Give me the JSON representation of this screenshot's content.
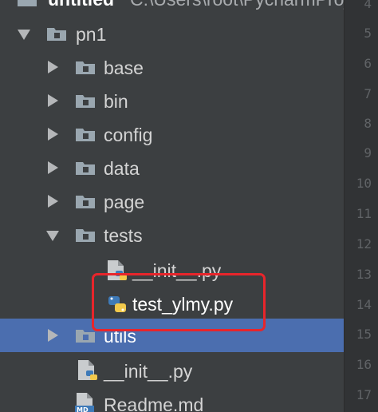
{
  "project_header": {
    "name": "untitled",
    "path": "C:\\Users\\root\\PycharmProjects\\untitled"
  },
  "tree": {
    "root": {
      "name": "pn1",
      "expanded": true
    },
    "folders": [
      {
        "name": "base",
        "expanded": false
      },
      {
        "name": "bin",
        "expanded": false
      },
      {
        "name": "config",
        "expanded": false
      },
      {
        "name": "data",
        "expanded": false
      },
      {
        "name": "page",
        "expanded": false
      },
      {
        "name": "tests",
        "expanded": true
      },
      {
        "name": "utils",
        "expanded": false,
        "selected": true
      }
    ],
    "tests_children": [
      {
        "name": "__init__.py",
        "icon": "python-file-icon"
      },
      {
        "name": "test_ylmy.py",
        "icon": "python-file-icon"
      }
    ],
    "root_files": [
      {
        "name": "__init__.py",
        "icon": "python-file-icon"
      },
      {
        "name": "Readme.md",
        "icon": "markdown-file-icon",
        "badge": "MD"
      }
    ]
  },
  "gutter": {
    "line_numbers": [
      "4",
      "5",
      "6",
      "7",
      "8",
      "9",
      "10",
      "11",
      "12",
      "13",
      "14",
      "15",
      "16",
      "17"
    ]
  },
  "colors": {
    "background": "#3c3f41",
    "selection": "#4b6eaf",
    "highlight_box": "#e8252b",
    "folder": "#9aa7b0"
  }
}
